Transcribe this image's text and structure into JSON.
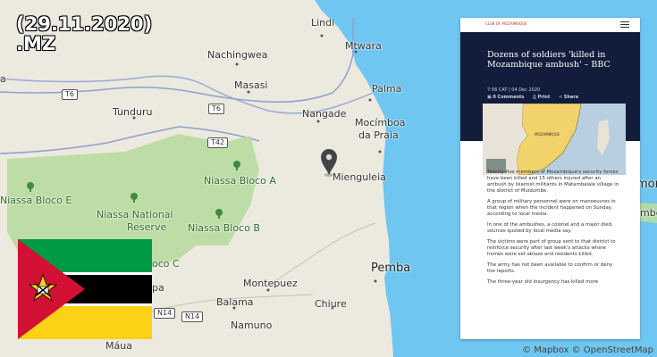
{
  "header": {
    "date": "(29.11.2020)",
    "country_code": ".MZ"
  },
  "map": {
    "colors": {
      "water": "#6fc6f0",
      "land": "#ece9df",
      "park": "#b9dca0",
      "road": "#8f9fcf"
    },
    "places": {
      "lindi": "Lindi",
      "mtwara": "Mtwara",
      "nachingwea": "Nachingwea",
      "masasi": "Masasi",
      "tunduru": "Tunduru",
      "nangade": "Nangade",
      "palma": "Palma",
      "mocimboa": "Mocímboa",
      "da_praia": "da Praia",
      "mienguleia": "Mienguleia",
      "niassa_bloco_a": "Niassa Bloco A",
      "niassa_bloco_b": "Niassa Bloco B",
      "niassa_bloco_c": "oco C",
      "niassa_bloco_e": "Niassa Bloco E",
      "niassa_national": "Niassa National",
      "reserve": "Reserve",
      "montepuez": "Montepuez",
      "balama": "Balama",
      "namuno": "Namuno",
      "chiure": "Chiure",
      "pemba": "Pemba",
      "maua": "Máua",
      "lichinga_partial": "pa",
      "moroni_partial": "mor",
      "comoros_partial": "mbo",
      "west_partial": "a"
    },
    "roads": {
      "t6a": "T6",
      "t6b": "T6",
      "t42": "T42",
      "n14a": "N14",
      "n14b": "N14"
    },
    "marker_icon": "map-pin-icon",
    "park_icon": "tree-icon"
  },
  "article": {
    "logo_text": "CLUB OF MOZAMBIQUE",
    "menu_icon": "hamburger-menu-icon",
    "title": "Dozens of soldiers 'killed in Mozambique ambush' – BBC",
    "meta": "7:58 CAT | 04 Dec 2020",
    "comments": "0 Comments",
    "print": "Print",
    "share": "Share",
    "map_label": "MOZAMBIQUE",
    "paragraphs": [
      "Twenty-five members of Mozambique's security forces have been killed and 15 others injured after an ambush by Islamist militants in Matambalale village in the district of Muidumbe.",
      "A group of military personnel were on manoeuvres in that region when the incident happened on Sunday, according to local media.",
      "In one of the ambushes, a colonel and a major died, sources quoted by local media say.",
      "The victims were part of group sent to that district to reinforce security after last week's attacks where homes were set ablaze and residents killed.",
      "The army has not been available to confirm or deny the reports.",
      "The three-year old insurgency has killed more"
    ]
  },
  "flag": {
    "country": "Mozambique",
    "colors": {
      "green": "#009a44",
      "black": "#000000",
      "yellow": "#fcd116",
      "red": "#d21034",
      "white": "#ffffff"
    }
  },
  "attribution": "© Mapbox © OpenStreetMap"
}
